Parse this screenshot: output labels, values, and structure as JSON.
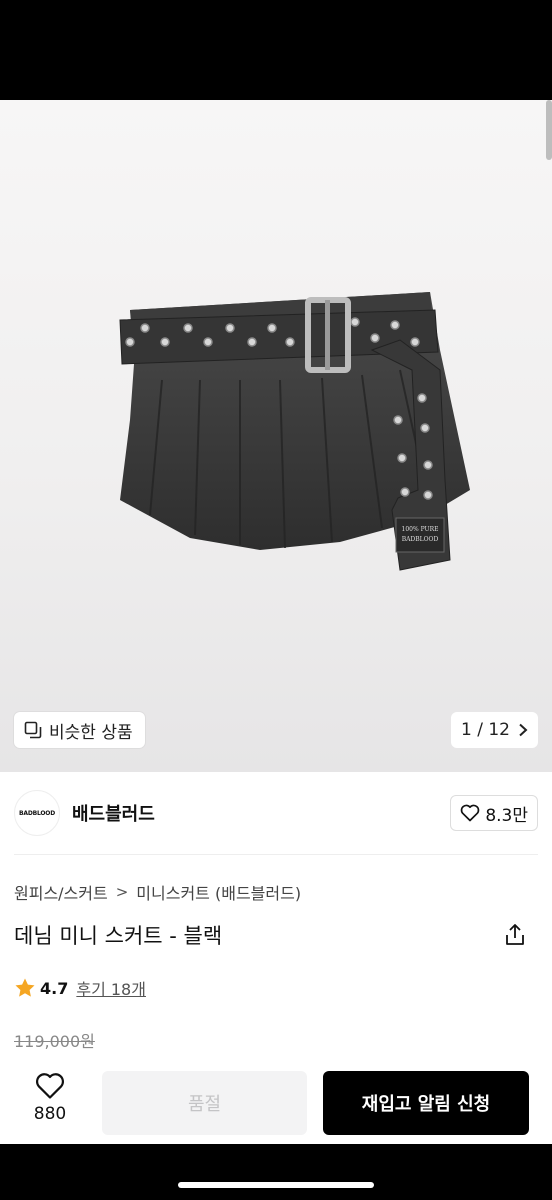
{
  "gallery": {
    "similar_label": "비슷한 상품",
    "page_indicator": "1 / 12",
    "image_tag_lines": [
      "100% PURE",
      "BADBLOOD"
    ]
  },
  "brand": {
    "logo_text": "BADBLOOD",
    "name": "배드블러드",
    "like_count": "8.3만"
  },
  "breadcrumb": {
    "category": "원피스/스커트",
    "separator": ">",
    "subcategory": "미니스커트 (배드블러드)"
  },
  "product": {
    "title": "데님 미니 스커트 - 블랙",
    "rating": "4.7",
    "review_label": "후기 18개",
    "original_price": "119,000원"
  },
  "bottom_bar": {
    "wish_count": "880",
    "soldout_label": "품절",
    "restock_label": "재입고 알림 신청"
  },
  "colors": {
    "accent": "#000000",
    "star": "#f5a623",
    "gallery_bg": "#f0efef"
  }
}
